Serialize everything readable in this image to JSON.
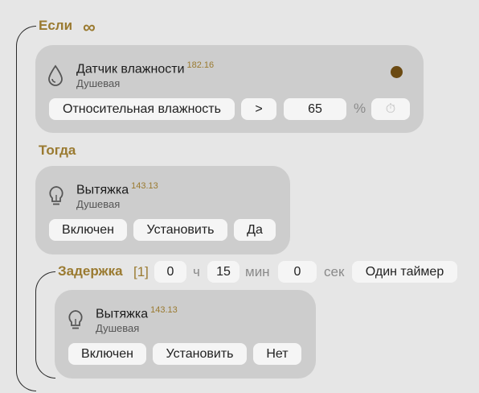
{
  "if_section": {
    "title": "Если",
    "condition": {
      "device_name": "Датчик влажности",
      "device_id": "182.16",
      "room": "Душевая",
      "status_color": "#6b4a12",
      "property": "Относительная влажность",
      "operator": ">",
      "value": "65",
      "unit": "%",
      "timer_icon": "stopwatch-icon",
      "device_icon": "water-drop-icon"
    }
  },
  "then_section": {
    "title": "Тогда",
    "action": {
      "device_name": "Вытяжка",
      "device_id": "143.13",
      "room": "Душевая",
      "state": "Включен",
      "verb": "Установить",
      "value": "Да",
      "device_icon": "lightbulb-icon"
    }
  },
  "delay_section": {
    "title": "Задержка",
    "index": "[1]",
    "hours": "0",
    "hours_unit": "ч",
    "minutes": "15",
    "minutes_unit": "мин",
    "seconds": "0",
    "seconds_unit": "сек",
    "timer_mode": "Один таймер",
    "action": {
      "device_name": "Вытяжка",
      "device_id": "143.13",
      "room": "Душевая",
      "state": "Включен",
      "verb": "Установить",
      "value": "Нет",
      "device_icon": "lightbulb-icon"
    }
  },
  "colors": {
    "accent": "#9a7a30",
    "background": "#e6e6e6",
    "card": "#cdcdcd",
    "pill": "#f5f5f5"
  }
}
